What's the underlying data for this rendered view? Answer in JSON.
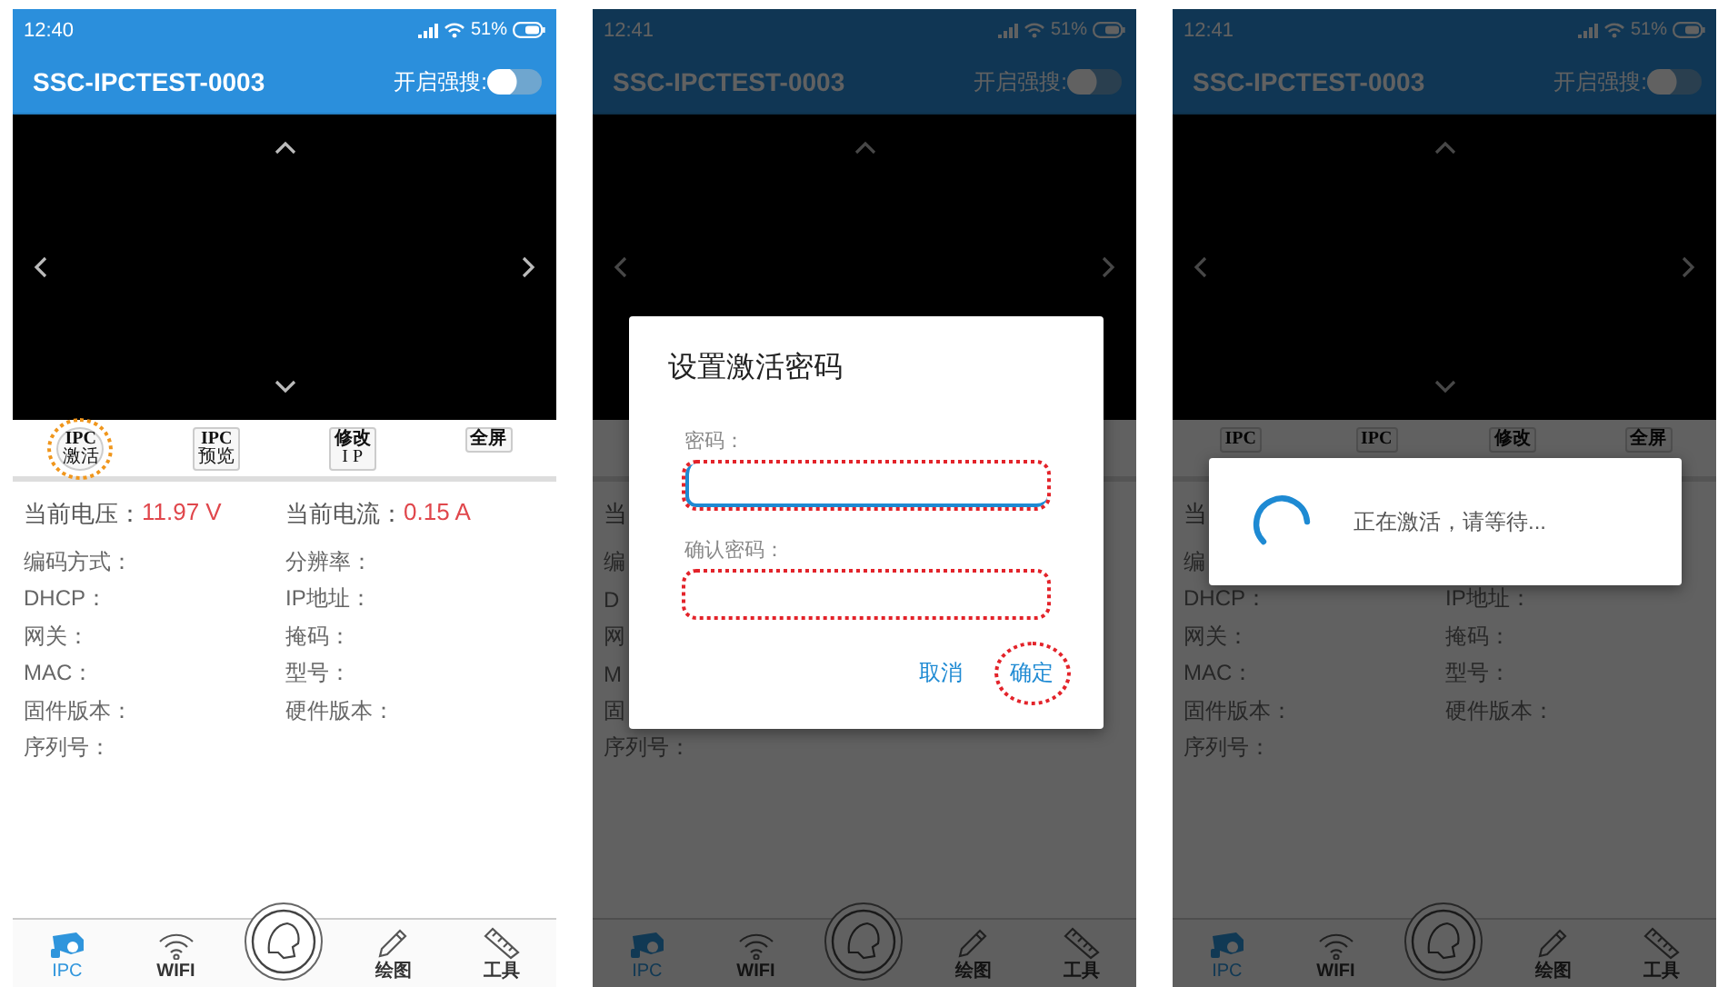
{
  "screens": [
    {
      "status": {
        "time": "12:40",
        "battery": "51%"
      },
      "title": "SSC-IPCTEST-0003",
      "toggle": {
        "label": "开启强搜:",
        "on": false
      },
      "tools": [
        {
          "lines": [
            "IPC",
            "激活"
          ],
          "highlighted": true
        },
        {
          "lines": [
            "IPC",
            "预览"
          ],
          "highlighted": false
        },
        {
          "lines": [
            "修改",
            "I P"
          ],
          "highlighted": false
        },
        {
          "lines": [
            "全屏"
          ],
          "highlighted": false
        }
      ],
      "readings": [
        {
          "label": "当前电压：",
          "value": "11.97 V"
        },
        {
          "label": "当前电流：",
          "value": "0.15 A"
        }
      ],
      "fields": [
        [
          "编码方式：",
          "分辨率："
        ],
        [
          "DHCP：",
          "IP地址："
        ],
        [
          "网关：",
          "掩码："
        ],
        [
          "MAC：",
          "型号："
        ],
        [
          "固件版本：",
          "硬件版本："
        ],
        [
          "序列号："
        ]
      ],
      "nav": [
        {
          "kind": "camera",
          "label": "IPC",
          "selected": true
        },
        {
          "kind": "wifi",
          "label": "WIFI",
          "selected": false
        },
        {
          "kind": "logo"
        },
        {
          "kind": "pencil",
          "label": "绘图",
          "selected": false
        },
        {
          "kind": "ruler",
          "label": "工具",
          "selected": false
        }
      ]
    },
    {
      "status": {
        "time": "12:41",
        "battery": "51%"
      },
      "title": "SSC-IPCTEST-0003",
      "toggle": {
        "label": "开启强搜:",
        "on": false
      },
      "readings": [
        {
          "label": "当"
        }
      ],
      "fields": [
        [
          "编"
        ],
        [
          "D"
        ],
        [
          "网"
        ],
        [
          "M"
        ],
        [
          "固"
        ],
        [
          "序列号："
        ]
      ],
      "nav": [
        {
          "kind": "camera",
          "label": "IPC",
          "selected": true
        },
        {
          "kind": "wifi",
          "label": "WIFI",
          "selected": false
        },
        {
          "kind": "logo"
        },
        {
          "kind": "pencil",
          "label": "绘图",
          "selected": false
        },
        {
          "kind": "ruler",
          "label": "工具",
          "selected": false
        }
      ],
      "dialog": {
        "kind": "password",
        "title": "设置激活密码",
        "inputs": [
          {
            "label": "密码：",
            "focused": true,
            "highlighted": true
          },
          {
            "label": "确认密码：",
            "focused": false,
            "highlighted": true
          }
        ],
        "buttons": [
          {
            "label": "取消",
            "highlighted": false
          },
          {
            "label": "确定",
            "highlighted": true
          }
        ]
      }
    },
    {
      "status": {
        "time": "12:41",
        "battery": "51%"
      },
      "title": "SSC-IPCTEST-0003",
      "toggle": {
        "label": "开启强搜:",
        "on": false
      },
      "tools": [
        {
          "lines": [
            "IPC"
          ],
          "highlighted": false
        },
        {
          "lines": [
            "IPC"
          ],
          "highlighted": false
        },
        {
          "lines": [
            "修改"
          ],
          "highlighted": false
        },
        {
          "lines": [
            "全屏"
          ],
          "highlighted": false
        }
      ],
      "readings": [
        {
          "label": "当"
        }
      ],
      "fields": [
        [
          "编"
        ],
        [
          "DHCP：",
          "IP地址："
        ],
        [
          "网关：",
          "掩码："
        ],
        [
          "MAC：",
          "型号："
        ],
        [
          "固件版本：",
          "硬件版本："
        ],
        [
          "序列号："
        ]
      ],
      "nav": [
        {
          "kind": "camera",
          "label": "IPC",
          "selected": true
        },
        {
          "kind": "wifi",
          "label": "WIFI",
          "selected": false
        },
        {
          "kind": "logo"
        },
        {
          "kind": "pencil",
          "label": "绘图",
          "selected": false
        },
        {
          "kind": "ruler",
          "label": "工具",
          "selected": false
        }
      ],
      "dialog": {
        "kind": "progress",
        "message": "正在激活，请等待..."
      }
    }
  ]
}
